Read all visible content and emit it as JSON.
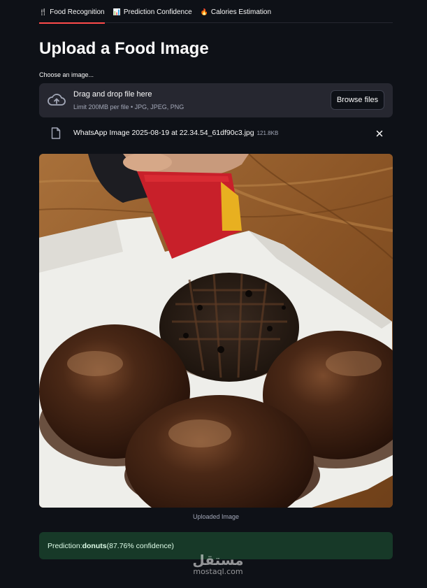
{
  "tabs": [
    {
      "icon": "🍴",
      "label": "Food Recognition",
      "active": true
    },
    {
      "icon": "📊",
      "label": "Prediction Confidence",
      "active": false
    },
    {
      "icon": "🔥",
      "label": "Calories Estimation",
      "active": false
    }
  ],
  "title": "Upload a Food Image",
  "uploader": {
    "label": "Choose an image...",
    "drag_text": "Drag and drop file here",
    "limits": "Limit 200MB per file • JPG, JPEG, PNG",
    "browse_label": "Browse files"
  },
  "uploaded_file": {
    "name": "WhatsApp Image 2025-08-19 at 22.34.54_61df90c3.jpg",
    "size": "121.8KB"
  },
  "image": {
    "caption": "Uploaded Image"
  },
  "prediction": {
    "prefix": "Prediction: ",
    "label": "donuts",
    "suffix": " (87.76% confidence)"
  },
  "watermark": {
    "arabic": "مستقل",
    "latin": "mostaql.com"
  },
  "colors": {
    "background": "#0e1117",
    "accent": "#ff4b4b",
    "success_bg": "#173928"
  }
}
